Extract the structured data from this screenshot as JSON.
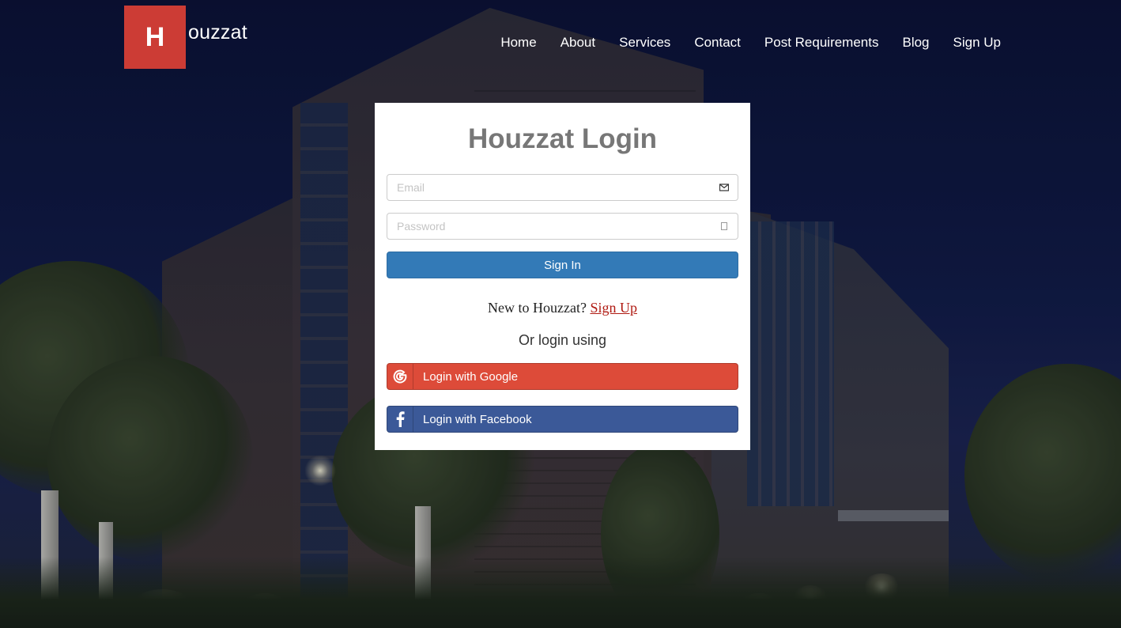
{
  "brand": {
    "logo_letter": "H",
    "logo_text": "ouzzat",
    "accent": "#cc3c35"
  },
  "nav": {
    "items": [
      {
        "label": "Home"
      },
      {
        "label": "About"
      },
      {
        "label": "Services"
      },
      {
        "label": "Contact"
      },
      {
        "label": "Post Requirements"
      },
      {
        "label": "Blog"
      },
      {
        "label": "Sign Up"
      }
    ]
  },
  "login": {
    "title": "Houzzat Login",
    "email": {
      "placeholder": "Email",
      "value": "",
      "icon": "envelope-icon"
    },
    "password": {
      "placeholder": "Password",
      "value": "",
      "icon": "lock-icon"
    },
    "sign_in_label": "Sign In",
    "sign_in_color": "#337ab7",
    "new_user_text": "New to Houzzat?",
    "sign_up_link": "Sign Up",
    "or_text": "Or login using",
    "google": {
      "label": "Login with Google",
      "icon": "google-icon",
      "color": "#dd4b39"
    },
    "facebook": {
      "label": "Login with Facebook",
      "icon": "facebook-icon",
      "color": "#3b5998"
    }
  }
}
